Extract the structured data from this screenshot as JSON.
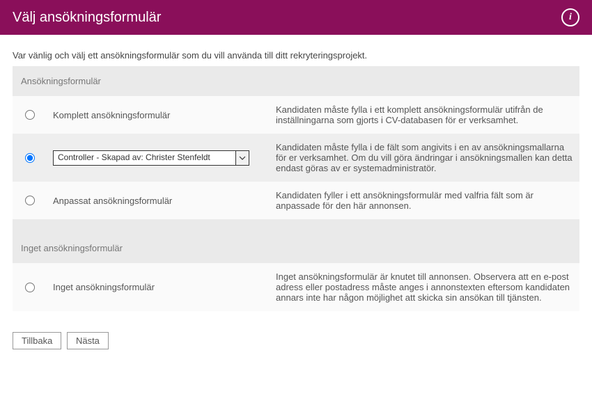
{
  "header": {
    "title": "Välj ansökningsformulär",
    "info_icon_label": "i"
  },
  "intro": "Var vänlig och välj ett ansökningsformulär som du vill använda till ditt rekryteringsprojekt.",
  "sections": {
    "forms": {
      "heading": "Ansökningsformulär",
      "complete": {
        "label": "Komplett ansökningsformulär",
        "desc": "Kandidaten måste fylla i ett komplett ansökningsformulär utifrån de inställningarna som gjorts i CV-databasen för er verksamhet."
      },
      "template": {
        "select_value": "Controller - Skapad av: Christer Stenfeldt",
        "desc": "Kandidaten måste fylla i de fält som angivits i en av ansökningsmallarna för er verksamhet. Om du vill göra ändringar i ansökningsmallen kan detta endast göras av er systemadministratör."
      },
      "custom": {
        "label": "Anpassat ansökningsformulär",
        "desc": "Kandidaten fyller i ett ansökningsformulär med valfria fält som är anpassade för den här annonsen."
      }
    },
    "none": {
      "heading": "Inget ansökningsformulär",
      "item": {
        "label": "Inget ansökningsformulär",
        "desc": "Inget ansökningsformulär är knutet till annonsen. Observera att en e-post adress eller postadress måste anges i annonstexten eftersom kandidaten annars inte har någon möjlighet att skicka sin ansökan till tjänsten."
      }
    }
  },
  "buttons": {
    "back": "Tillbaka",
    "next": "Nästa"
  }
}
